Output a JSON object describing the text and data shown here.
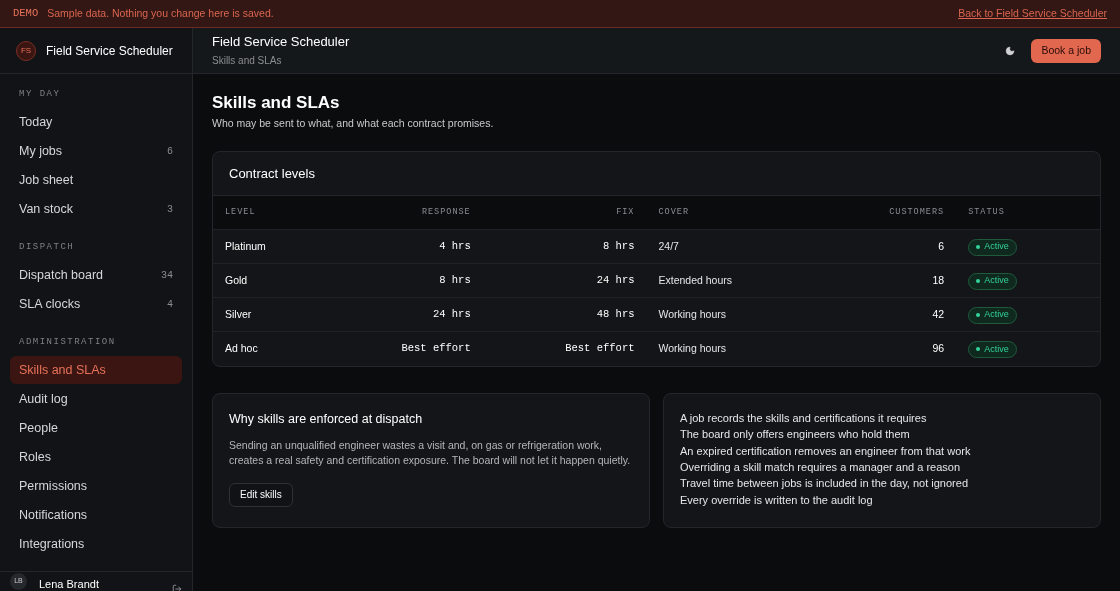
{
  "banner": {
    "tag": "DEMO",
    "message": "Sample data. Nothing you change here is saved.",
    "link": "Back to Field Service Scheduler"
  },
  "sidebar": {
    "logo": "FS",
    "app_name": "Field Service Scheduler",
    "sections": [
      {
        "heading": "MY DAY",
        "items": [
          {
            "label": "Today",
            "selected": false
          },
          {
            "label": "My jobs",
            "count": "6",
            "selected": false
          },
          {
            "label": "Job sheet",
            "selected": false
          },
          {
            "label": "Van stock",
            "count": "3",
            "selected": false
          }
        ]
      },
      {
        "heading": "DISPATCH",
        "items": [
          {
            "label": "Dispatch board",
            "count": "34",
            "selected": false
          },
          {
            "label": "SLA clocks",
            "count": "4",
            "selected": false
          }
        ]
      },
      {
        "heading": "ADMINISTRATION",
        "items": [
          {
            "label": "Skills and SLAs",
            "selected": true
          },
          {
            "label": "Audit log",
            "selected": false
          },
          {
            "label": "People",
            "selected": false
          },
          {
            "label": "Roles",
            "selected": false
          },
          {
            "label": "Permissions",
            "selected": false
          },
          {
            "label": "Notifications",
            "selected": false
          },
          {
            "label": "Integrations",
            "selected": false
          }
        ]
      }
    ],
    "user": {
      "initials": "LB",
      "name": "Lena Brandt"
    }
  },
  "header": {
    "title": "Field Service Scheduler",
    "subtitle": "Skills and SLAs",
    "primary_button": "Book a job"
  },
  "page": {
    "title": "Skills and SLAs",
    "subtitle": "Who may be sent to what, and what each contract promises."
  },
  "table": {
    "title": "Contract levels",
    "columns": [
      "LEVEL",
      "RESPONSE",
      "FIX",
      "COVER",
      "CUSTOMERS",
      "STATUS"
    ],
    "rows": [
      {
        "level": "Platinum",
        "response": "4 hrs",
        "fix": "8 hrs",
        "cover": "24/7",
        "customers": "6",
        "status": "Active",
        "color": "#34d399"
      },
      {
        "level": "Gold",
        "response": "8 hrs",
        "fix": "24 hrs",
        "cover": "Extended hours",
        "customers": "18",
        "status": "Active",
        "color": "#34d399"
      },
      {
        "level": "Silver",
        "response": "24 hrs",
        "fix": "48 hrs",
        "cover": "Working hours",
        "customers": "42",
        "status": "Active",
        "color": "#34d399"
      },
      {
        "level": "Ad hoc",
        "response": "Best effort",
        "fix": "Best effort",
        "cover": "Working hours",
        "customers": "96",
        "status": "Active",
        "color": "#34d399"
      }
    ]
  },
  "explainer": {
    "title": "Why skills are enforced at dispatch",
    "body": "Sending an unqualified engineer wastes a visit and, on gas or refrigeration work, creates a real safety and certification exposure. The board will not let it happen quietly.",
    "button": "Edit skills"
  },
  "rules": [
    "A job records the skills and certifications it requires",
    "The board only offers engineers who hold them",
    "An expired certification removes an engineer from that work",
    "Overriding a skill match requires a manager and a reason",
    "Travel time between jobs is included in the day, not ignored",
    "Every override is written to the audit log"
  ]
}
